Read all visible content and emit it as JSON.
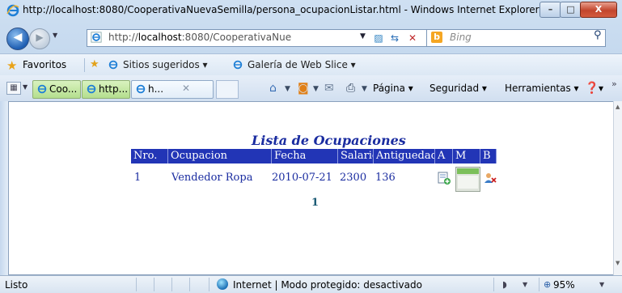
{
  "window": {
    "title": "http://localhost:8080/CooperativaNuevaSemilla/persona_ocupacionListar.html - Windows Internet Explorer",
    "min_icon": "minimize-icon",
    "max_icon": "maximize-icon",
    "close_icon": "close-icon",
    "min_glyph": "–",
    "max_glyph": "□",
    "close_glyph": "X"
  },
  "address": {
    "url_prefix": "http://",
    "url_host": "localhost",
    "url_rest": ":8080/CooperativaNue",
    "search_placeholder": "Bing",
    "back_glyph": "◀",
    "fwd_glyph": "▶"
  },
  "favorites": {
    "label": "Favoritos",
    "items": [
      "Sitios sugeridos ▾",
      "Galería de Web Slice ▾"
    ]
  },
  "tabs": {
    "items": [
      {
        "label": "Coo..."
      },
      {
        "label": "http..."
      },
      {
        "label": "h..."
      }
    ],
    "close_glyph": "✕"
  },
  "commandbar": {
    "page": "Página ▾",
    "security": "Seguridad ▾",
    "tools": "Herramientas ▾",
    "help": "▾"
  },
  "page": {
    "title": "Lista de Ocupaciones",
    "columns": [
      "Nro.",
      "Ocupacion",
      "Fecha",
      "Salario",
      "Antiguedad",
      "A",
      "M",
      "B"
    ],
    "rows": [
      {
        "nro": "1",
        "ocupacion": "Vendedor Ropa",
        "fecha": "2010-07-21",
        "salario": "2300",
        "antiguedad": "136"
      }
    ],
    "pager": "1",
    "row_icons": [
      "add-record-icon",
      "edit-record-icon",
      "delete-user-icon"
    ]
  },
  "status": {
    "text": "Listo",
    "zone": "Internet | Modo protegido: desactivado",
    "zoom": "95%"
  },
  "colors": {
    "header_bg": "#2235b6",
    "link": "#1a2ca0",
    "pager": "#1a5a74",
    "close_button": "#c2452d"
  }
}
